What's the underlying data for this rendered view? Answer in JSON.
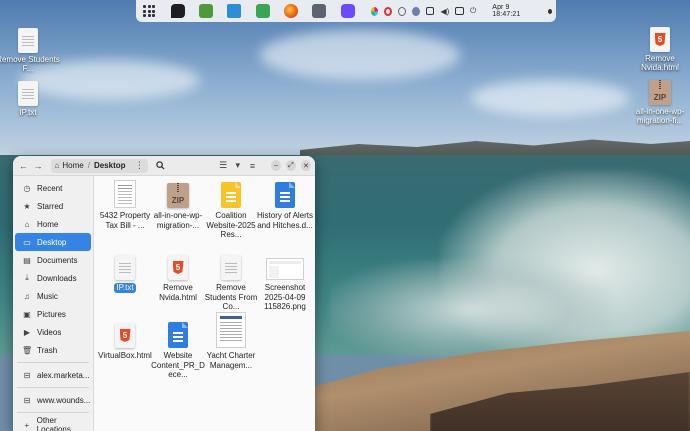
{
  "dock": {
    "apps": [
      {
        "name": "app-grid-icon"
      },
      {
        "name": "chat-app-icon",
        "color": "#1f1f1f"
      },
      {
        "name": "archive-app-icon",
        "color": "#4e9a3a"
      },
      {
        "name": "camera-app-icon",
        "color": "#2a8fd6"
      },
      {
        "name": "system-monitor-icon",
        "color": "#3aa655"
      },
      {
        "name": "firefox-icon",
        "color": "#e66000"
      },
      {
        "name": "settings-app-icon",
        "color": "#5b6470"
      },
      {
        "name": "proton-vpn-icon",
        "color": "#6d4aff"
      }
    ],
    "tray": [
      {
        "name": "slack-tray-icon",
        "color": "#e01e5a"
      },
      {
        "name": "record-tray-icon",
        "color": "#d33"
      },
      {
        "name": "sync-tray-icon",
        "color": "#666"
      },
      {
        "name": "night-light-tray-icon",
        "color": "#555"
      },
      {
        "name": "screen-tray-icon",
        "color": "#333"
      },
      {
        "name": "volume-tray-icon",
        "color": "#333"
      },
      {
        "name": "network-tray-icon",
        "color": "#333"
      },
      {
        "name": "power-tray-icon",
        "color": "#333"
      }
    ],
    "clock": "Apr 9  18:47:21"
  },
  "desktop": {
    "icons": [
      {
        "label": "Remove Students F...",
        "type": "doc"
      },
      {
        "label": "IP.txt",
        "type": "doc"
      },
      {
        "label": "Remove Nvida.html",
        "type": "html"
      },
      {
        "label": "all-in-one-wp-migration-fi...",
        "type": "zip"
      }
    ]
  },
  "filemanager": {
    "path_home": "Home",
    "path_current": "Desktop",
    "sidebar": [
      {
        "label": "Recent",
        "icon": "clock-icon",
        "glyph": "◷"
      },
      {
        "label": "Starred",
        "icon": "star-icon",
        "glyph": "★"
      },
      {
        "label": "Home",
        "icon": "home-icon",
        "glyph": "⌂"
      },
      {
        "label": "Desktop",
        "icon": "desktop-icon",
        "glyph": "▭",
        "active": true
      },
      {
        "label": "Documents",
        "icon": "documents-icon",
        "glyph": "▤"
      },
      {
        "label": "Downloads",
        "icon": "downloads-icon",
        "glyph": "⤓"
      },
      {
        "label": "Music",
        "icon": "music-icon",
        "glyph": "♫"
      },
      {
        "label": "Pictures",
        "icon": "pictures-icon",
        "glyph": "▣"
      },
      {
        "label": "Videos",
        "icon": "videos-icon",
        "glyph": "▶"
      },
      {
        "label": "Trash",
        "icon": "trash-icon",
        "glyph": "🗑"
      },
      {
        "label": "alex.marketa...",
        "icon": "network-drive-icon",
        "glyph": "⊟"
      },
      {
        "label": "www.wounds...",
        "icon": "network-drive-icon",
        "glyph": "⊟"
      },
      {
        "label": "Other Locations",
        "icon": "plus-icon",
        "glyph": "+"
      }
    ],
    "files": [
      {
        "label": "5432 Property Tax Bill - ...",
        "type": "pdf"
      },
      {
        "label": "all-in-one-wp-migration-...",
        "type": "zip"
      },
      {
        "label": "Coalition Website-2025 Res...",
        "type": "gdoc-yellow"
      },
      {
        "label": "History of Alerts and Hitches.d...",
        "type": "gdoc-blue"
      },
      {
        "label": "IP.txt",
        "type": "text",
        "selected": true
      },
      {
        "label": "Remove Nvida.html",
        "type": "html"
      },
      {
        "label": "Remove Students From Co...",
        "type": "text"
      },
      {
        "label": "Screenshot 2025-04-09 115826.png",
        "type": "png"
      },
      {
        "label": "VirtualBox.html",
        "type": "html"
      },
      {
        "label": "Website Content_PR_Dece...",
        "type": "gdoc-blue"
      },
      {
        "label": "Yacht Charter Managem...",
        "type": "yacht"
      }
    ]
  }
}
